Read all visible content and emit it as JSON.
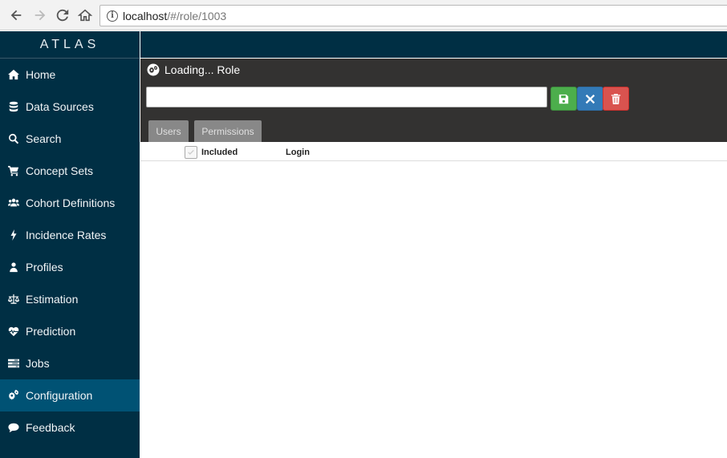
{
  "browser": {
    "url_host": "localhost",
    "url_path": "/#/role/1003"
  },
  "sidebar": {
    "brand": "ATLAS",
    "items": [
      {
        "label": "Home",
        "icon": "home-icon"
      },
      {
        "label": "Data Sources",
        "icon": "database-icon"
      },
      {
        "label": "Search",
        "icon": "search-icon"
      },
      {
        "label": "Concept Sets",
        "icon": "cart-icon"
      },
      {
        "label": "Cohort Definitions",
        "icon": "users-icon"
      },
      {
        "label": "Incidence Rates",
        "icon": "bolt-icon"
      },
      {
        "label": "Profiles",
        "icon": "user-icon"
      },
      {
        "label": "Estimation",
        "icon": "balance-scale-icon"
      },
      {
        "label": "Prediction",
        "icon": "heartbeat-icon"
      },
      {
        "label": "Jobs",
        "icon": "tasks-icon"
      },
      {
        "label": "Configuration",
        "icon": "cogs-icon",
        "active": true
      },
      {
        "label": "Feedback",
        "icon": "comment-icon"
      }
    ]
  },
  "panel": {
    "title": "Loading... Role",
    "name_value": "",
    "tabs": [
      {
        "label": "Users"
      },
      {
        "label": "Permissions"
      }
    ]
  },
  "table": {
    "columns": [
      "Included",
      "Login"
    ]
  },
  "colors": {
    "sidebar_bg": "#002f44",
    "sidebar_active": "#005274",
    "panel_bg": "#333231",
    "save": "#4cae4c",
    "close": "#337ab7",
    "delete": "#d9534f"
  }
}
